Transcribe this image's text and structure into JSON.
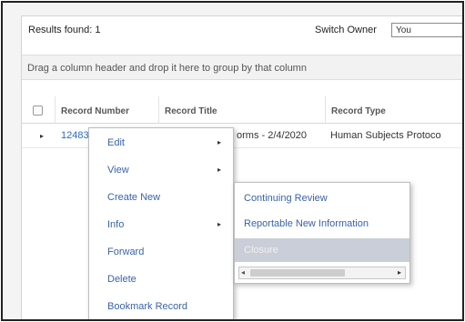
{
  "toolbar": {
    "results_label": "Results found: 1",
    "switch_owner_label": "Switch Owner",
    "owner_value": "You"
  },
  "group_hint": "Drag a column header and drop it here to group by that column",
  "grid": {
    "columns": [
      "Record Number",
      "Record Title",
      "Record Type"
    ],
    "rows": [
      {
        "record_number": "12483",
        "record_title": "orms - 2/4/2020",
        "record_type": "Human Subjects Protoco"
      }
    ]
  },
  "context_menu": {
    "items": [
      {
        "label": "Edit",
        "has_submenu": true
      },
      {
        "label": "View",
        "has_submenu": true
      },
      {
        "label": "Create New",
        "has_submenu": false
      },
      {
        "label": "Info",
        "has_submenu": true
      },
      {
        "label": "Forward",
        "has_submenu": false
      },
      {
        "label": "Delete",
        "has_submenu": false
      },
      {
        "label": "Bookmark Record",
        "has_submenu": false
      }
    ],
    "submenu_arrow": "▸"
  },
  "create_new_submenu": {
    "items": [
      {
        "label": "Continuing Review",
        "selected": false
      },
      {
        "label": "Reportable New Information",
        "selected": false
      },
      {
        "label": "Closure",
        "selected": true
      }
    ]
  },
  "icons": {
    "expand": "▸",
    "scroll_left": "◂",
    "scroll_right": "▸"
  },
  "colors": {
    "link": "#2a6cbf",
    "menu_text": "#3a63a8",
    "selected_bg": "#c9ced8"
  }
}
